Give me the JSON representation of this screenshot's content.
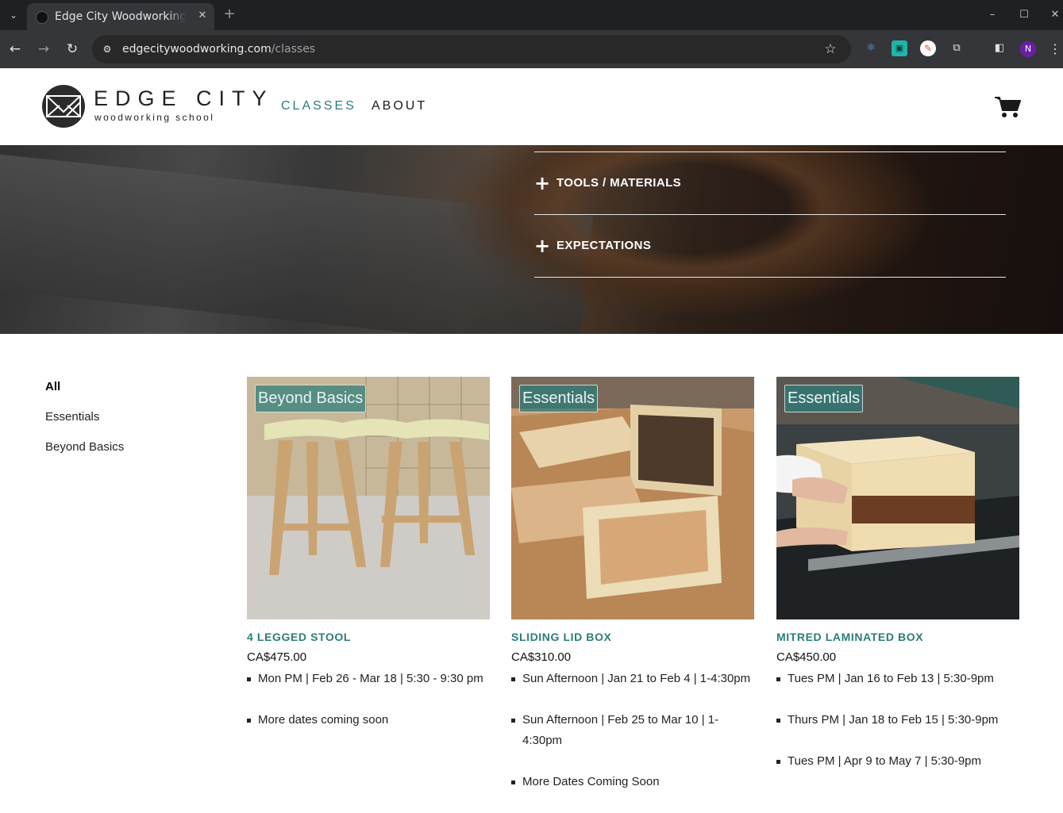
{
  "browser": {
    "tab_title": "Edge City Woodworking",
    "tab_close_icon": "close-icon",
    "new_tab_symbol": "+",
    "url_host": "edgecitywoodworking.com",
    "url_path": "/classes",
    "profile_initial": "N",
    "window_controls": [
      "minimize-icon",
      "maximize-icon",
      "close-icon"
    ]
  },
  "header": {
    "logo_title": "EDGE CITY",
    "logo_subtitle": "woodworking school",
    "nav": [
      {
        "label": "CLASSES",
        "active": true
      },
      {
        "label": "ABOUT",
        "active": false
      }
    ],
    "cart_icon": "cart-icon",
    "accent_color": "#2b7d7a"
  },
  "hero": {
    "accordion": [
      {
        "icon": "plus-icon",
        "label": "TOOLS / MATERIALS"
      },
      {
        "icon": "plus-icon",
        "label": "EXPECTATIONS"
      }
    ]
  },
  "filters": [
    {
      "label": "All",
      "active": true
    },
    {
      "label": "Essentials",
      "active": false
    },
    {
      "label": "Beyond Basics",
      "active": false
    }
  ],
  "products": [
    {
      "tag": "Beyond Basics",
      "title": "4 LEGGED STOOL",
      "price": "CA$475.00",
      "dates": [
        "Mon PM | Feb 26 - Mar 18 | 5:30 - 9:30 pm",
        "More dates coming soon"
      ]
    },
    {
      "tag": "Essentials",
      "title": "SLIDING LID BOX",
      "price": "CA$310.00",
      "dates": [
        "Sun Afternoon | Jan 21 to Feb 4 | 1-4:30pm",
        "Sun Afternoon | Feb 25 to Mar 10 | 1-4:30pm",
        "More Dates Coming Soon"
      ]
    },
    {
      "tag": "Essentials",
      "title": "MITRED LAMINATED BOX",
      "price": "CA$450.00",
      "dates": [
        "Tues PM | Jan 16 to Feb 13 | 5:30-9pm",
        "Thurs PM | Jan 18 to Feb 15 | 5:30-9pm",
        "Tues PM | Apr 9 to May 7 | 5:30-9pm"
      ]
    }
  ]
}
